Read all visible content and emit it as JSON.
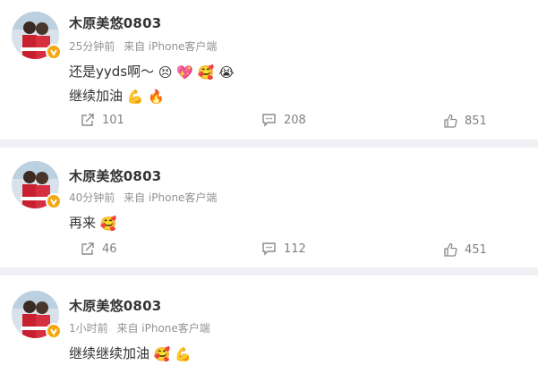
{
  "posts": [
    {
      "username": "木原美悠0803",
      "time": "25分钟前",
      "source": "来自 iPhone客户端",
      "lines": [
        "还是yyds啊〜",
        "继续加油"
      ],
      "line1_emojis": [
        "😣",
        "💖",
        "🥰",
        "😭"
      ],
      "line2_emojis": [
        "💪",
        "🔥"
      ],
      "repost": "101",
      "comment": "208",
      "like": "851"
    },
    {
      "username": "木原美悠0803",
      "time": "40分钟前",
      "source": "来自 iPhone客户端",
      "lines": [
        "再来"
      ],
      "line1_emojis": [
        "🥰"
      ],
      "line2_emojis": [],
      "repost": "46",
      "comment": "112",
      "like": "451"
    },
    {
      "username": "木原美悠0803",
      "time": "1小时前",
      "source": "来自 iPhone客户端",
      "lines": [
        "继续继续加油"
      ],
      "line1_emojis": [
        "🥰",
        "💪"
      ],
      "line2_emojis": [],
      "repost": "",
      "comment": "",
      "like": ""
    }
  ],
  "colors": {
    "verified": "#f3a60d",
    "separator": "#f0f0f4",
    "meta": "#939393"
  }
}
